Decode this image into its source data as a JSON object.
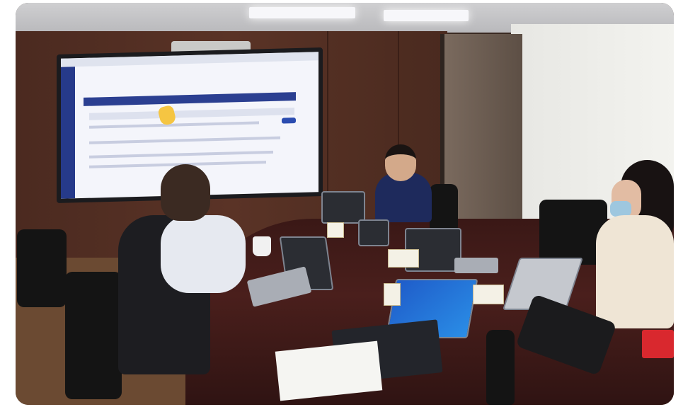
{
  "photo": {
    "scene": "meeting-room"
  },
  "colors": {
    "wood_wall": "#5a3326",
    "table": "#3a1816",
    "screen": "#f4f5fb",
    "screen_sidebar": "#263a8a",
    "laptop_screen": "#1f5cc9"
  }
}
